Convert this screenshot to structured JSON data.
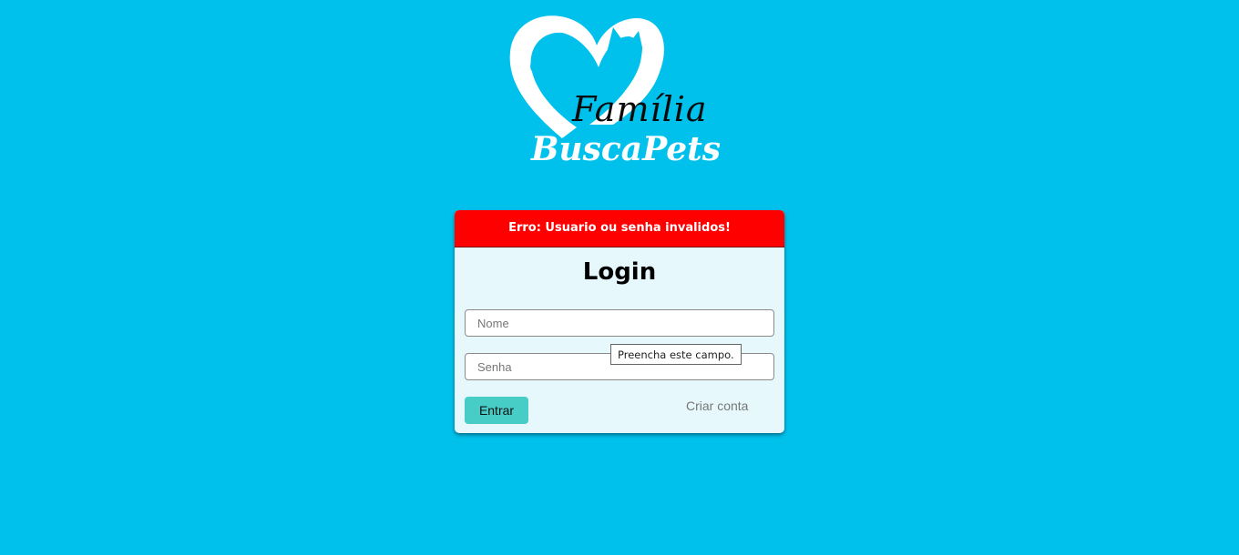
{
  "logo": {
    "line1": "Família",
    "line2": "BuscaPets"
  },
  "error": {
    "message": "Erro: Usuario ou senha invalidos!"
  },
  "login": {
    "title": "Login",
    "name_placeholder": "Nome",
    "password_placeholder": "Senha",
    "tooltip": "Preencha este campo.",
    "submit_label": "Entrar",
    "create_account_label": "Criar conta"
  },
  "colors": {
    "background": "#00c1ec",
    "error": "#ff0000",
    "button": "#48ccc6"
  }
}
